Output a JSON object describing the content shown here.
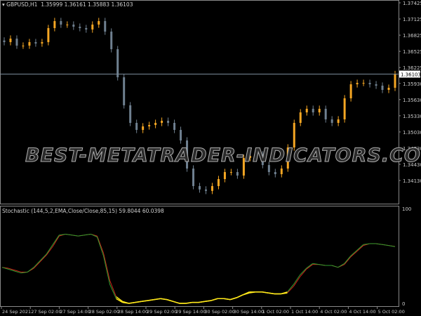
{
  "header": {
    "symbol": "GBPUSD,H1",
    "ohlc": "1.35999 1.36161 1.35883 1.36103",
    "menu_icon": "triangle-down-icon"
  },
  "indicator": {
    "label": "Stochastic (144,5,2,EMA,Close/Close,85,15) 59.8044 60.0398"
  },
  "watermark": "BEST-METATRADER-INDICATORS.COM",
  "colors": {
    "bull": "#f5a623",
    "bear": "#6f8090",
    "stoch_main": "#2e9e2e",
    "stoch_signal": "#d0201a",
    "stoch_extreme": "#ffe81a",
    "current_price_line": "#7a8a99"
  },
  "price_axis": {
    "ticks": [
      "1.37425",
      "1.37125",
      "1.36825",
      "1.36525",
      "1.36225",
      "1.35930",
      "1.35630",
      "1.35330",
      "1.35030",
      "1.34730",
      "1.34430",
      "1.34130"
    ],
    "current": "1.36103",
    "range": [
      1.3413,
      1.37425
    ]
  },
  "stoch_axis": {
    "ticks": [
      "100",
      "0"
    ]
  },
  "time_axis": {
    "ticks": [
      "24 Sep 2021",
      "27 Sep 02:00",
      "27 Sep 14:00",
      "28 Sep 02:00",
      "28 Sep 14:00",
      "29 Sep 02:00",
      "29 Sep 14:00",
      "30 Sep 02:00",
      "30 Sep 14:00",
      "1 Oct 02:00",
      "1 Oct 14:00",
      "4 Oct 02:00",
      "4 Oct 14:00",
      "5 Oct 02:00"
    ]
  },
  "chart_data": [
    {
      "type": "candlestick",
      "series": [
        {
          "values": [
            1.36696,
            1.36761,
            1.36631,
            1.36631,
            1.36696,
            1.3667,
            1.36696,
            1.36956,
            1.37086,
            1.37021,
            1.37021,
            1.36982,
            1.36956,
            1.3693,
            1.37021,
            1.37086,
            1.36891,
            1.36565,
            1.36044,
            1.35524,
            1.35198,
            1.35068,
            1.35133,
            1.35159,
            1.35198,
            1.35237,
            1.35198,
            1.35068,
            1.34872,
            1.34351,
            1.34026,
            1.33963,
            1.33937,
            1.34026,
            1.34156,
            1.34286,
            1.34286,
            1.34221,
            1.34547,
            1.34586,
            1.34612,
            1.34416,
            1.34286,
            1.34247,
            1.34351,
            1.34742,
            1.35198,
            1.35393,
            1.35459,
            1.35393,
            1.35459,
            1.35263,
            1.35198,
            1.35263,
            1.35654,
            1.35914,
            1.3594,
            1.3594,
            1.35914,
            1.35888,
            1.3581,
            1.35849,
            1.36103
          ]
        }
      ],
      "ylim": [
        1.3405,
        1.37425
      ]
    },
    {
      "type": "line",
      "ylim": [
        0,
        100
      ],
      "series": [
        {
          "values": [
            38,
            36,
            34,
            32,
            33,
            38,
            45,
            52,
            62,
            72,
            73,
            72,
            71,
            72,
            73,
            70,
            50,
            20,
            5,
            1,
            0,
            1,
            2,
            3,
            4,
            5,
            4,
            2,
            0,
            0,
            1,
            1,
            2,
            3,
            5,
            5,
            4,
            6,
            9,
            12,
            12,
            12,
            11,
            10,
            10,
            12,
            20,
            30,
            37,
            42,
            41,
            40,
            40,
            38,
            42,
            50,
            56,
            62,
            63,
            63,
            62,
            61,
            59.8044
          ]
        },
        {
          "values": [
            38,
            37,
            35,
            33,
            33,
            37,
            44,
            51,
            60,
            71,
            73,
            72,
            71,
            72,
            73,
            71,
            53,
            24,
            7,
            2,
            0,
            1,
            2,
            3,
            4,
            5,
            4,
            2,
            0,
            0,
            1,
            1,
            2,
            3,
            5,
            5,
            4,
            6,
            9,
            11,
            12,
            12,
            11,
            10,
            10,
            11,
            18,
            28,
            36,
            41,
            41,
            40,
            40,
            38,
            41,
            49,
            55,
            61,
            63,
            63,
            62,
            61,
            60.0398
          ]
        }
      ]
    }
  ]
}
